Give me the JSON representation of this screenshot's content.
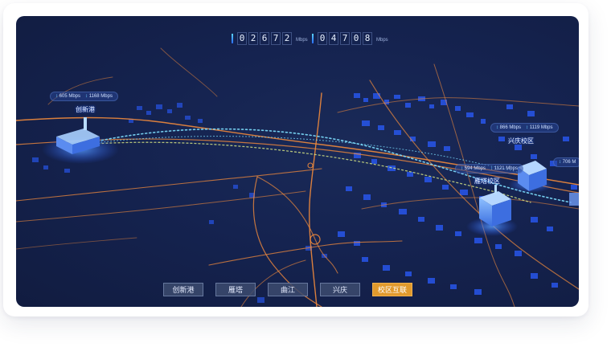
{
  "top_stats": [
    {
      "digits": [
        "0",
        "2",
        "6",
        "7",
        "2"
      ],
      "unit": "Mbps"
    },
    {
      "digits": [
        "0",
        "4",
        "7",
        "0",
        "8"
      ],
      "unit": "Mbps"
    }
  ],
  "nodes": [
    {
      "name": "创新港",
      "up": "605 Mbps",
      "down": "1168 Mbps"
    },
    {
      "name": "兴庆校区",
      "up": "866 Mbps",
      "down": "1119 Mbps"
    },
    {
      "name": "雁塔校区",
      "up": "594 Mbps",
      "down": "1121 Mbps"
    },
    {
      "name": "",
      "up": "",
      "down": "706 M"
    }
  ],
  "tabs": [
    {
      "label": "创新港",
      "active": false
    },
    {
      "label": "雁塔",
      "active": false
    },
    {
      "label": "曲江",
      "active": false
    },
    {
      "label": "兴庆",
      "active": false
    },
    {
      "label": "校区互联",
      "active": true
    }
  ],
  "colors": {
    "background": "#152350",
    "road": "#f08a3c",
    "building": "#2a5cff",
    "active_tab": "#e19a2d",
    "link": "#7ee0ff"
  }
}
